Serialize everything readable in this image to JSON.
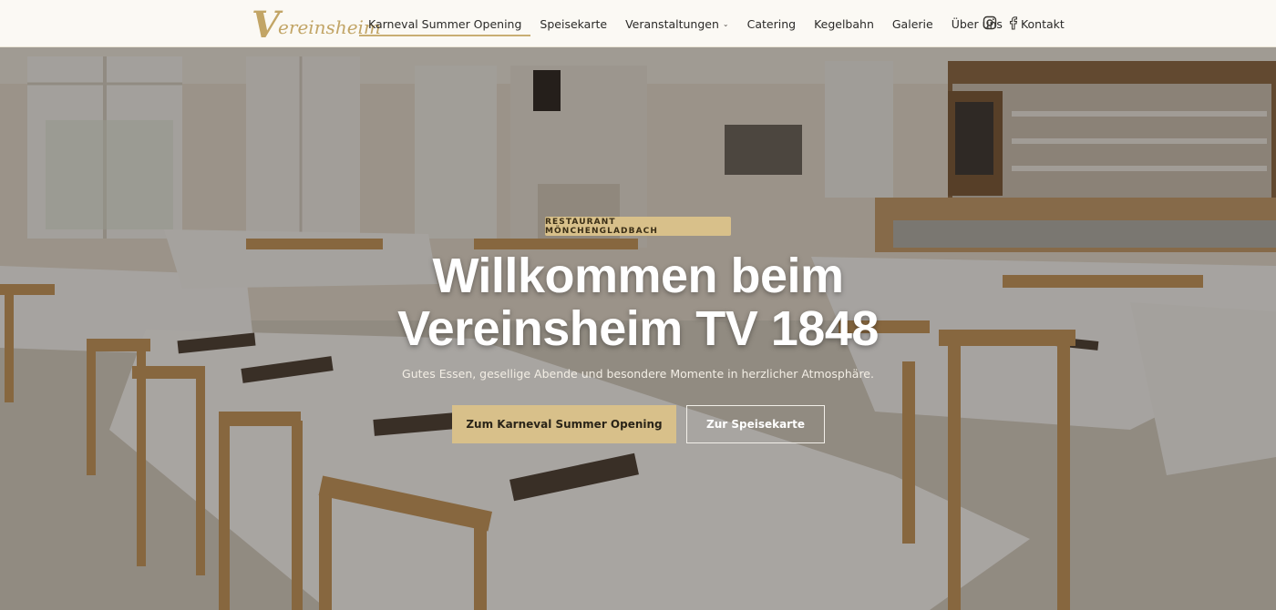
{
  "brand": {
    "logo_initial": "V",
    "logo_text": "ereinsheim"
  },
  "nav": {
    "items": [
      {
        "label": "Karneval Summer Opening",
        "active": true
      },
      {
        "label": "Speisekarte"
      },
      {
        "label": "Veranstaltungen",
        "dropdown": true
      },
      {
        "label": "Catering"
      },
      {
        "label": "Kegelbahn"
      },
      {
        "label": "Galerie"
      },
      {
        "label": "Über uns"
      },
      {
        "label": "Kontakt"
      }
    ],
    "dropdown_caret": "⌄"
  },
  "social": {
    "icons": [
      "instagram-icon",
      "facebook-icon"
    ]
  },
  "hero": {
    "badge": "RESTAURANT MÖNCHENGLADBACH",
    "title_line1": "Willkommen beim",
    "title_line2": "Vereinsheim TV 1848",
    "subtitle": "Gutes Essen, gesellige Abende und besondere Momente in herzlicher Atmosphäre.",
    "primary_button": "Zum Karneval Summer Opening",
    "secondary_button": "Zur Speisekarte"
  },
  "colors": {
    "accent": "#d8c08a",
    "logo": "#c2a566",
    "header_bg": "#fbf9f4",
    "text_dark": "#2b2a28"
  }
}
